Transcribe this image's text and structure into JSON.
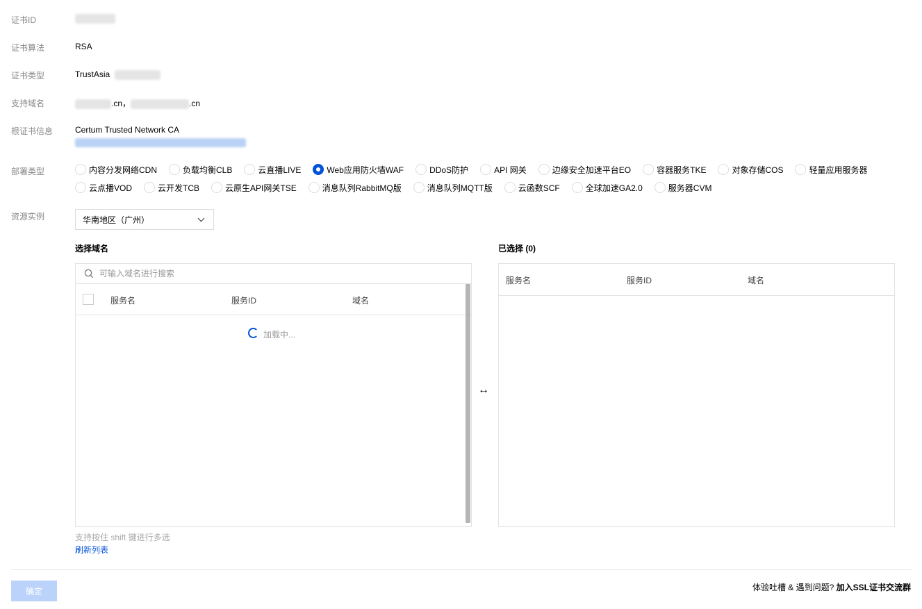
{
  "fields": {
    "cert_id_label": "证书ID",
    "algorithm_label": "证书算法",
    "algorithm_value": "RSA",
    "type_label": "证书类型",
    "type_value": "TrustAsia",
    "domains_label": "支持域名",
    "domain_suffix_1": ".cn，",
    "domain_suffix_2": ".cn",
    "root_label": "根证书信息",
    "root_value": "Certum Trusted Network CA",
    "deploy_label": "部署类型",
    "resource_label": "资源实例"
  },
  "deploy_types": {
    "row1": [
      {
        "label": "内容分发网络CDN",
        "checked": false
      },
      {
        "label": "负载均衡CLB",
        "checked": false
      },
      {
        "label": "云直播LIVE",
        "checked": false
      },
      {
        "label": "Web应用防火墙WAF",
        "checked": true
      },
      {
        "label": "DDoS防护",
        "checked": false
      },
      {
        "label": "API 网关",
        "checked": false
      },
      {
        "label": "边缘安全加速平台EO",
        "checked": false
      },
      {
        "label": "容器服务TKE",
        "checked": false
      },
      {
        "label": "对象存储COS",
        "checked": false
      },
      {
        "label": "轻量应用服务器",
        "checked": false
      }
    ],
    "row2": [
      {
        "label": "云点播VOD",
        "checked": false
      },
      {
        "label": "云开发TCB",
        "checked": false
      },
      {
        "label": "云原生API网关TSE",
        "checked": false
      },
      {
        "label": "消息队列RabbitMQ版",
        "checked": false
      },
      {
        "label": "消息队列MQTT版",
        "checked": false
      },
      {
        "label": "云函数SCF",
        "checked": false
      },
      {
        "label": "全球加速GA2.0",
        "checked": false
      },
      {
        "label": "服务器CVM",
        "checked": false
      }
    ]
  },
  "region_select": {
    "value": "华南地区（广州）"
  },
  "left_panel": {
    "title": "选择域名",
    "search_placeholder": "可输入域名进行搜索",
    "columns": [
      "服务名",
      "服务ID",
      "域名"
    ],
    "loading_text": "加载中..."
  },
  "right_panel": {
    "title": "已选择 (0)",
    "columns": [
      "服务名",
      "服务ID",
      "域名"
    ]
  },
  "hint_text": "支持按住 shift 键进行多选",
  "refresh_label": "刷新列表",
  "confirm_label": "确定",
  "feedback": {
    "text": "体验吐槽 & 遇到问题? ",
    "link": "加入SSL证书交流群"
  },
  "colors": {
    "primary": "#0052d9",
    "disabled_button": "#bbd3fb",
    "label": "#888888"
  }
}
